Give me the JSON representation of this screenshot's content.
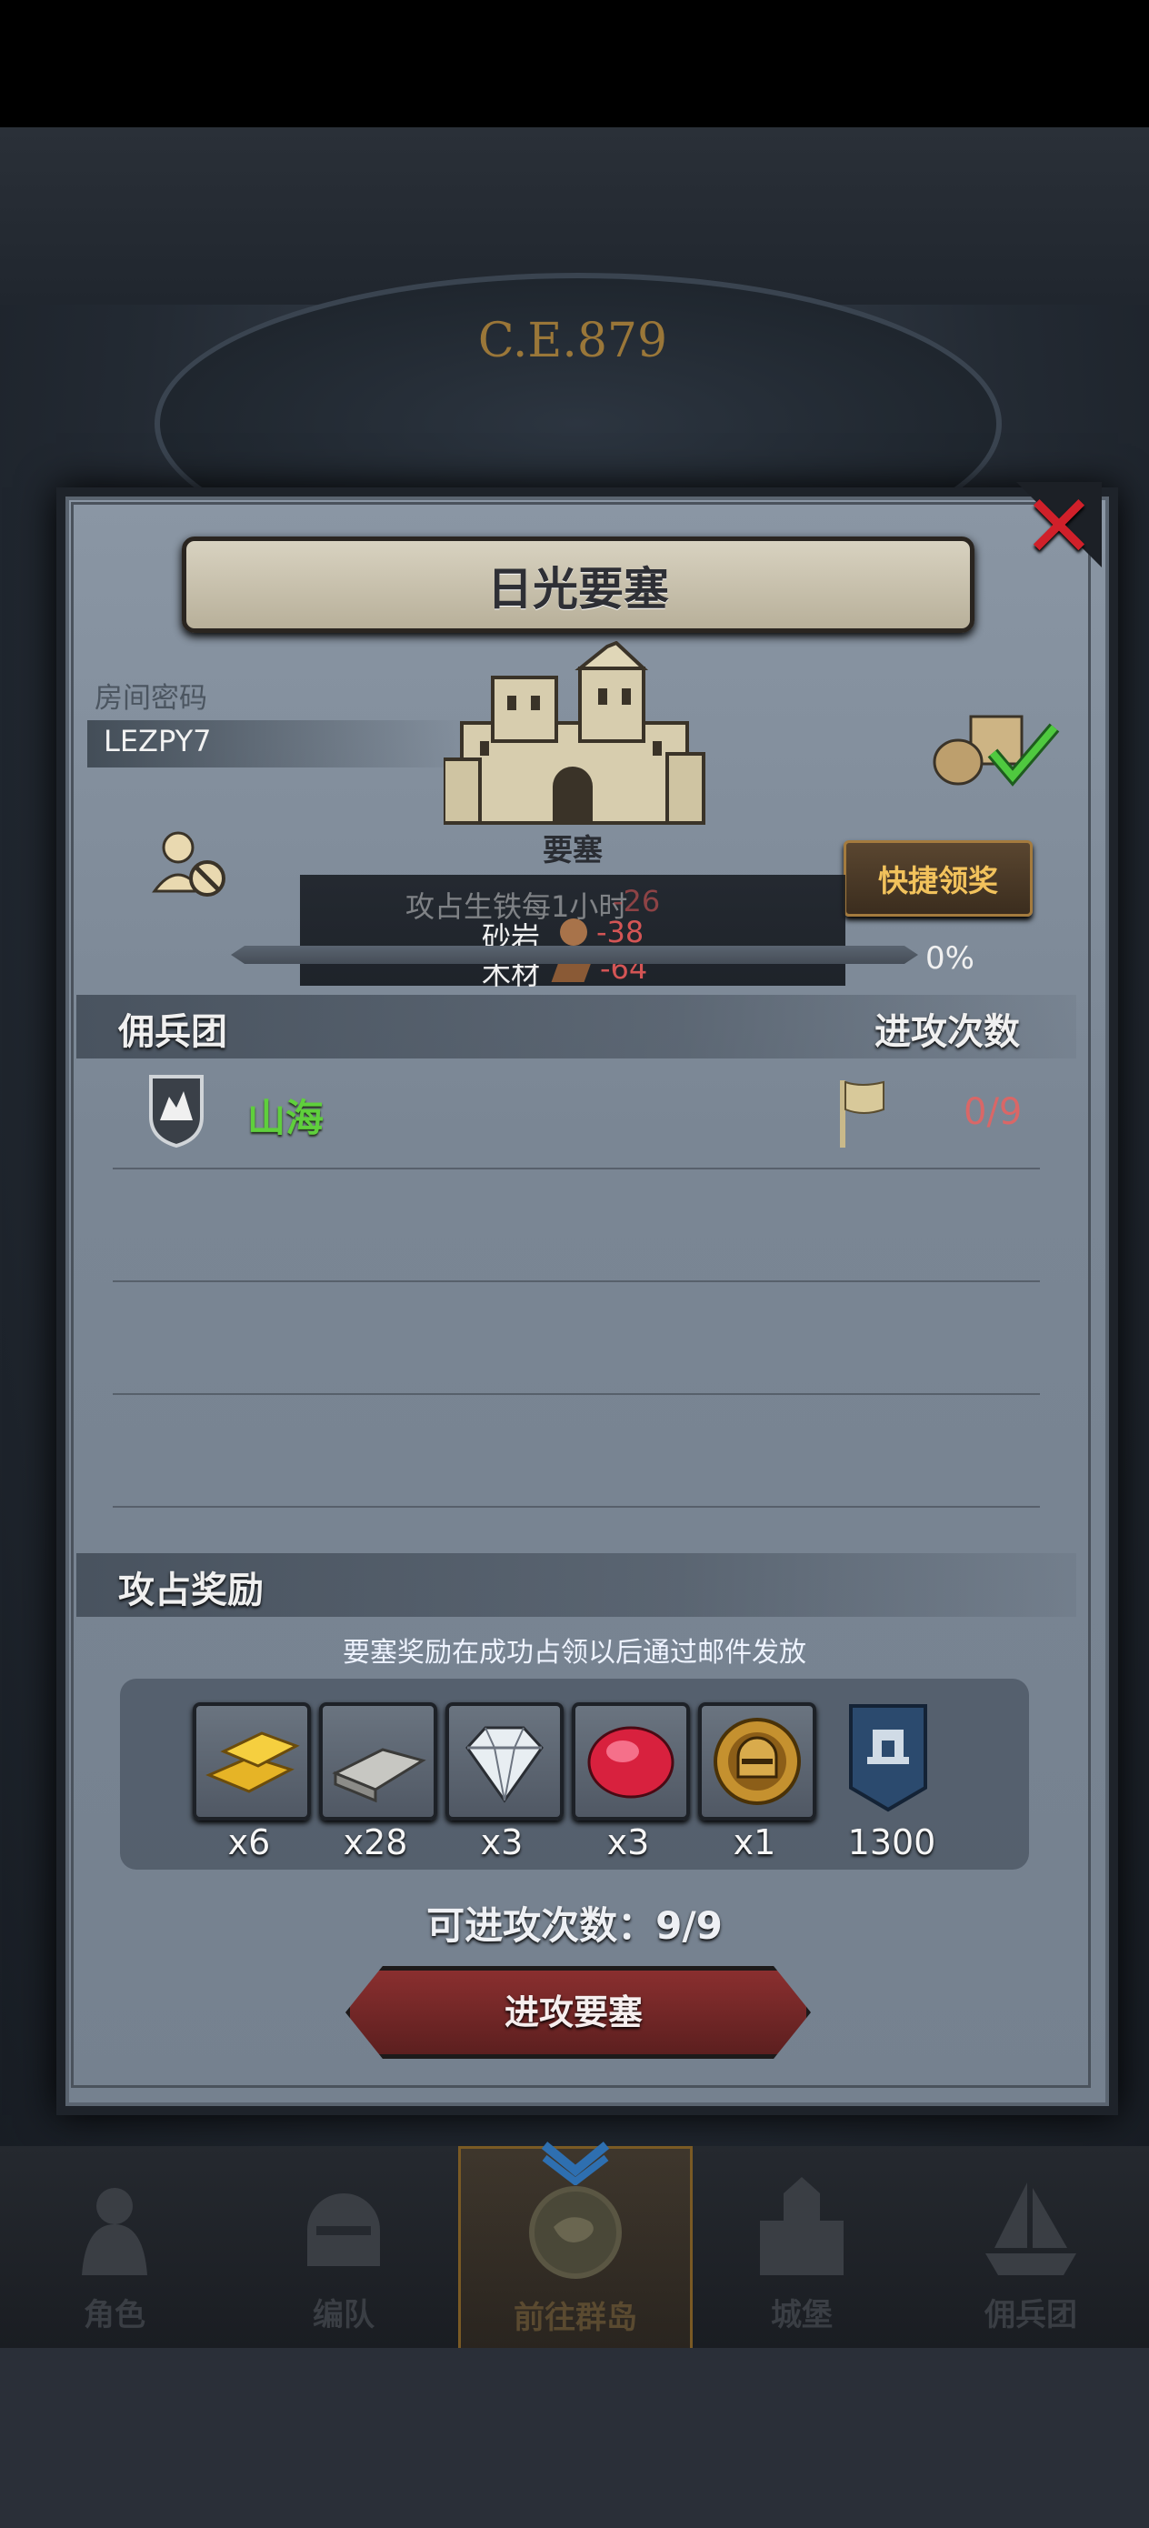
{
  "header": {
    "era": "C.E.879"
  },
  "dialog": {
    "title": "日光要塞",
    "room_code_label": "房间密码",
    "room_code": "LEZPY7",
    "castle_label": "要塞",
    "quick_claim": "快捷领奖",
    "production": {
      "hidden_text": "攻占生铁每1小时",
      "iron_value": "-26",
      "items": [
        {
          "name": "砂岩",
          "value": "-38"
        },
        {
          "name": "木材",
          "value": "-64"
        }
      ]
    },
    "progress": {
      "percent": 0,
      "text": "0%"
    },
    "mercenary": {
      "header": "佣兵团",
      "attack_header": "进攻次数",
      "row": {
        "name": "山海",
        "count": "0/9"
      }
    },
    "rewards": {
      "header": "攻占奖励",
      "note": "要塞奖励在成功占领以后通过邮件发放",
      "items": [
        {
          "icon": "gold-bar-icon",
          "qty": "x6"
        },
        {
          "icon": "iron-ingot-icon",
          "qty": "x28"
        },
        {
          "icon": "diamond-icon",
          "qty": "x3"
        },
        {
          "icon": "ruby-icon",
          "qty": "x3"
        },
        {
          "icon": "helmet-medal-icon",
          "qty": "x1"
        },
        {
          "icon": "guild-banner-icon",
          "qty": "1300"
        }
      ]
    },
    "attack_remaining": "可进攻次数：9/9",
    "attack_button": "进攻要塞",
    "close_icon": "close-icon"
  },
  "nav": {
    "items": [
      {
        "label": "角色",
        "icon": "knight-icon",
        "active": false
      },
      {
        "label": "编队",
        "icon": "helmet-icon",
        "active": false
      },
      {
        "label": "前往群岛",
        "icon": "compass-map-icon",
        "active": true
      },
      {
        "label": "城堡",
        "icon": "castle-icon",
        "active": false
      },
      {
        "label": "佣兵团",
        "icon": "ship-icon",
        "active": false
      }
    ]
  },
  "colors": {
    "accent_green": "#5fcf3c",
    "accent_red": "#d96767",
    "gold": "#f2c25c",
    "close_red": "#d0202a"
  }
}
